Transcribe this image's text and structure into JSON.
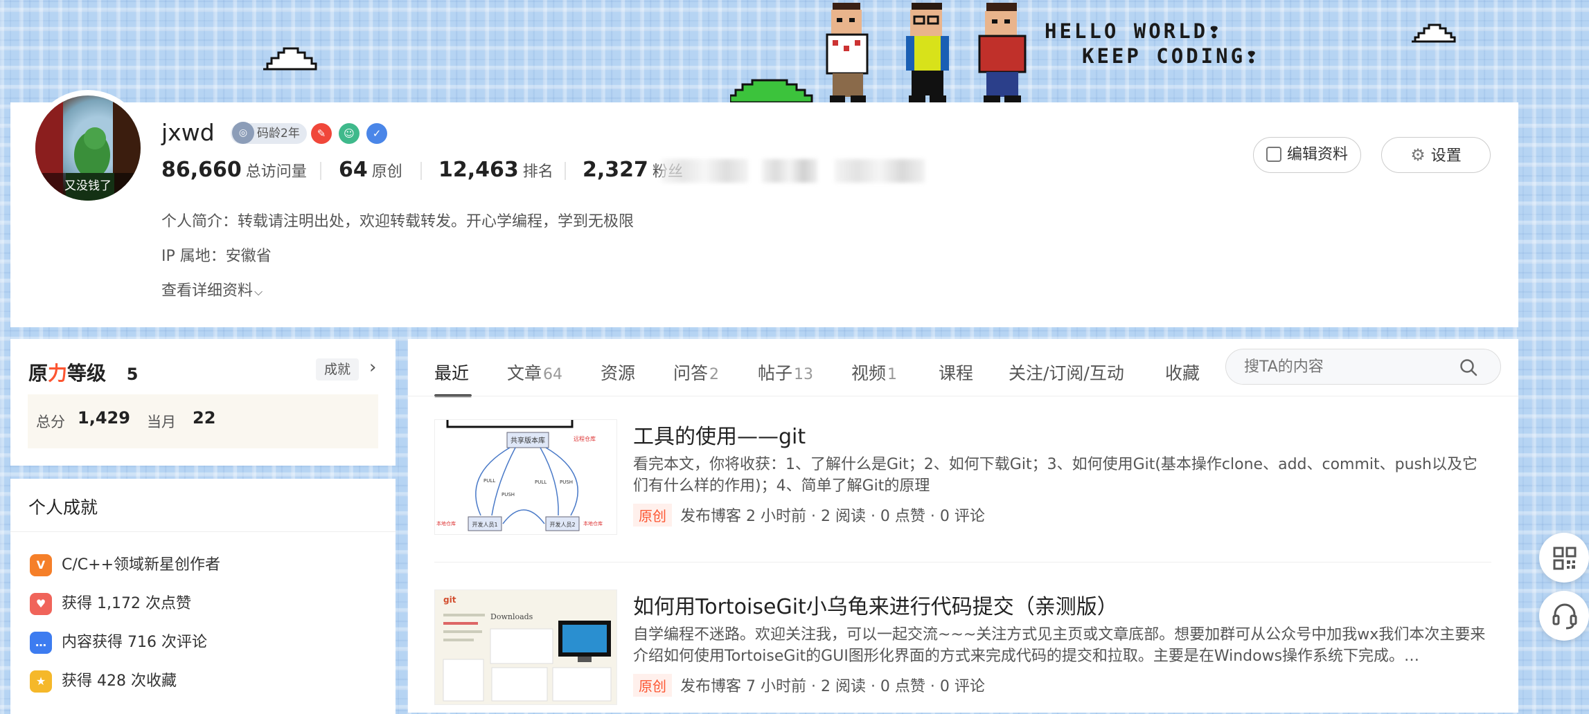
{
  "banner": {
    "line1": "HELLO WORLD❢",
    "line2": "KEEP CODING❢"
  },
  "profile": {
    "avatar_caption": "又没钱了",
    "username": "jxwd",
    "code_age_badge": "码龄2年",
    "stats": [
      {
        "num": "86,660",
        "label": "总访问量"
      },
      {
        "num": "64",
        "label": "原创"
      },
      {
        "num": "12,463",
        "label": "排名"
      },
      {
        "num": "2,327",
        "label": "粉丝"
      }
    ],
    "bio": "个人简介：转载请注明出处，欢迎转载转发。开心学编程，学到无极限",
    "ip": "IP 属地：安徽省",
    "details_link": "查看详细资料",
    "edit_button": "编辑资料",
    "settings_button": "设置"
  },
  "level": {
    "title_prefix": "原",
    "title_accent": "力",
    "title_suffix": "等级",
    "level_value": "5",
    "achievements_button": "成就",
    "total_label": "总分",
    "total_value": "1,429",
    "month_label": "当月",
    "month_value": "22"
  },
  "achievements": {
    "title": "个人成就",
    "items": [
      {
        "icon": "V",
        "color": "#f57f29",
        "text": "C/C++领域新星创作者"
      },
      {
        "icon": "♥",
        "color": "#f0645a",
        "text": "获得 1,172 次点赞"
      },
      {
        "icon": "…",
        "color": "#3d7cf0",
        "text": "内容获得 716 次评论"
      },
      {
        "icon": "★",
        "color": "#f5b82a",
        "text": "获得 428 次收藏"
      }
    ]
  },
  "tabs": [
    {
      "label": "最近",
      "count": ""
    },
    {
      "label": "文章",
      "count": "64"
    },
    {
      "label": "资源",
      "count": ""
    },
    {
      "label": "问答",
      "count": "2"
    },
    {
      "label": "帖子",
      "count": "13"
    },
    {
      "label": "视频",
      "count": "1"
    },
    {
      "label": "课程",
      "count": ""
    },
    {
      "label": "关注/订阅/互动",
      "count": ""
    },
    {
      "label": "收藏",
      "count": ""
    }
  ],
  "search": {
    "placeholder": "搜TA的内容"
  },
  "articles": [
    {
      "title": "工具的使用——git",
      "desc": "看完本文，你将收获：1、了解什么是Git；2、如何下载Git；3、如何使用Git(基本操作clone、add、commit、push以及它们有什么样的作用)；4、简单了解Git的原理",
      "tag": "原创",
      "meta": "发布博客 2 小时前 · 2 阅读 · 0 点赞 · 0 评论",
      "thumb_labels": [
        "共享版本库",
        "远程仓库",
        "开发人员1",
        "开发人员2",
        "本地仓库",
        "本地仓库",
        "PULL",
        "PUSH",
        "PULL",
        "PUSH"
      ]
    },
    {
      "title": "如何用TortoiseGit小乌龟来进行代码提交（亲测版）",
      "desc": "自学编程不迷路。欢迎关注我，可以一起交流~~~关注方式见主页或文章底部。想要加群可从公众号中加我wx我们本次主要来介绍如何使用TortoiseGit的GUI图形化界面的方式来完成代码的提交和拉取。主要是在Windows操作系统下完成。…",
      "tag": "原创",
      "meta": "发布博客 7 小时前 · 2 阅读 · 0 点赞 · 0 评论",
      "thumb_labels": [
        "git",
        "Downloads"
      ]
    }
  ]
}
